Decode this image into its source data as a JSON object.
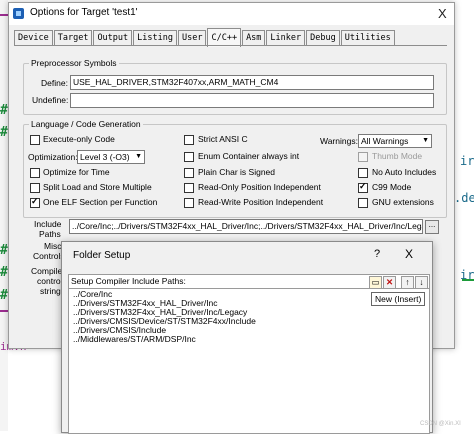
{
  "background": {
    "left_marks": [
      "#",
      "#",
      "#",
      "#",
      "#"
    ],
    "right_text": [
      "ir",
      ".de",
      "ir"
    ],
    "code_line": "im.h\""
  },
  "dialog": {
    "title": "Options for Target 'test1'",
    "close_glyph": "X",
    "tabs": [
      "Device",
      "Target",
      "Output",
      "Listing",
      "User",
      "C/C++",
      "Asm",
      "Linker",
      "Debug",
      "Utilities"
    ],
    "active_tab": "C/C++",
    "preprocessor": {
      "group_title": "Preprocessor Symbols",
      "define_label": "Define:",
      "define_value": "USE_HAL_DRIVER,STM32F407xx,ARM_MATH_CM4",
      "undefine_label": "Undefine:",
      "undefine_value": ""
    },
    "language": {
      "group_title": "Language / Code Generation",
      "execute_only": {
        "label": "Execute-only Code",
        "checked": false
      },
      "optimization_label": "Optimization:",
      "optimization_value": "Level 3 (-O3)",
      "optimize_time": {
        "label": "Optimize for Time",
        "checked": false
      },
      "split_load": {
        "label": "Split Load and Store Multiple",
        "checked": false
      },
      "one_elf": {
        "label": "One ELF Section per Function",
        "checked": true
      },
      "strict_ansi": {
        "label": "Strict ANSI C",
        "checked": false
      },
      "enum_container": {
        "label": "Enum Container always int",
        "checked": false
      },
      "plain_char": {
        "label": "Plain Char is Signed",
        "checked": false
      },
      "ro_pi": {
        "label": "Read-Only Position Independent",
        "checked": false
      },
      "rw_pi": {
        "label": "Read-Write Position Independent",
        "checked": false
      },
      "warnings_label": "Warnings:",
      "warnings_value": "All Warnings",
      "thumb_mode": {
        "label": "Thumb Mode",
        "checked": false
      },
      "no_auto_includes": {
        "label": "No Auto Includes",
        "checked": false
      },
      "c99_mode": {
        "label": "C99 Mode",
        "checked": true
      },
      "gnu_extensions": {
        "label": "GNU extensions",
        "checked": false
      }
    },
    "include_label": "Include",
    "paths_label": "Paths",
    "include_value": "../Core/Inc;../Drivers/STM32F4xx_HAL_Driver/Inc;../Drivers/STM32F4xx_HAL_Driver/Inc/Legacy;",
    "browse_label": "...",
    "misc_label": "Misc",
    "controls_label": "Controls",
    "compiler_label": "Compiler",
    "control_label": "control",
    "string_label": "string"
  },
  "folder_setup": {
    "title": "Folder Setup",
    "help": "?",
    "close": "X",
    "list_header": "Setup Compiler Include Paths:",
    "tooltip": "New (Insert)",
    "toolbar": {
      "new_icon": "new-folder-icon",
      "delete_icon": "delete-icon",
      "up_icon": "move-up-icon",
      "down_icon": "move-down-icon"
    },
    "paths": [
      "../Core/Inc",
      "../Drivers/STM32F4xx_HAL_Driver/Inc",
      "../Drivers/STM32F4xx_HAL_Driver/Inc/Legacy",
      "../Drivers/CMSIS/Device/ST/STM32F4xx/Include",
      "../Drivers/CMSIS/Include",
      "../Middlewares/ST/ARM/DSP/Inc"
    ]
  },
  "watermark": "CSDN @Xin.XI"
}
